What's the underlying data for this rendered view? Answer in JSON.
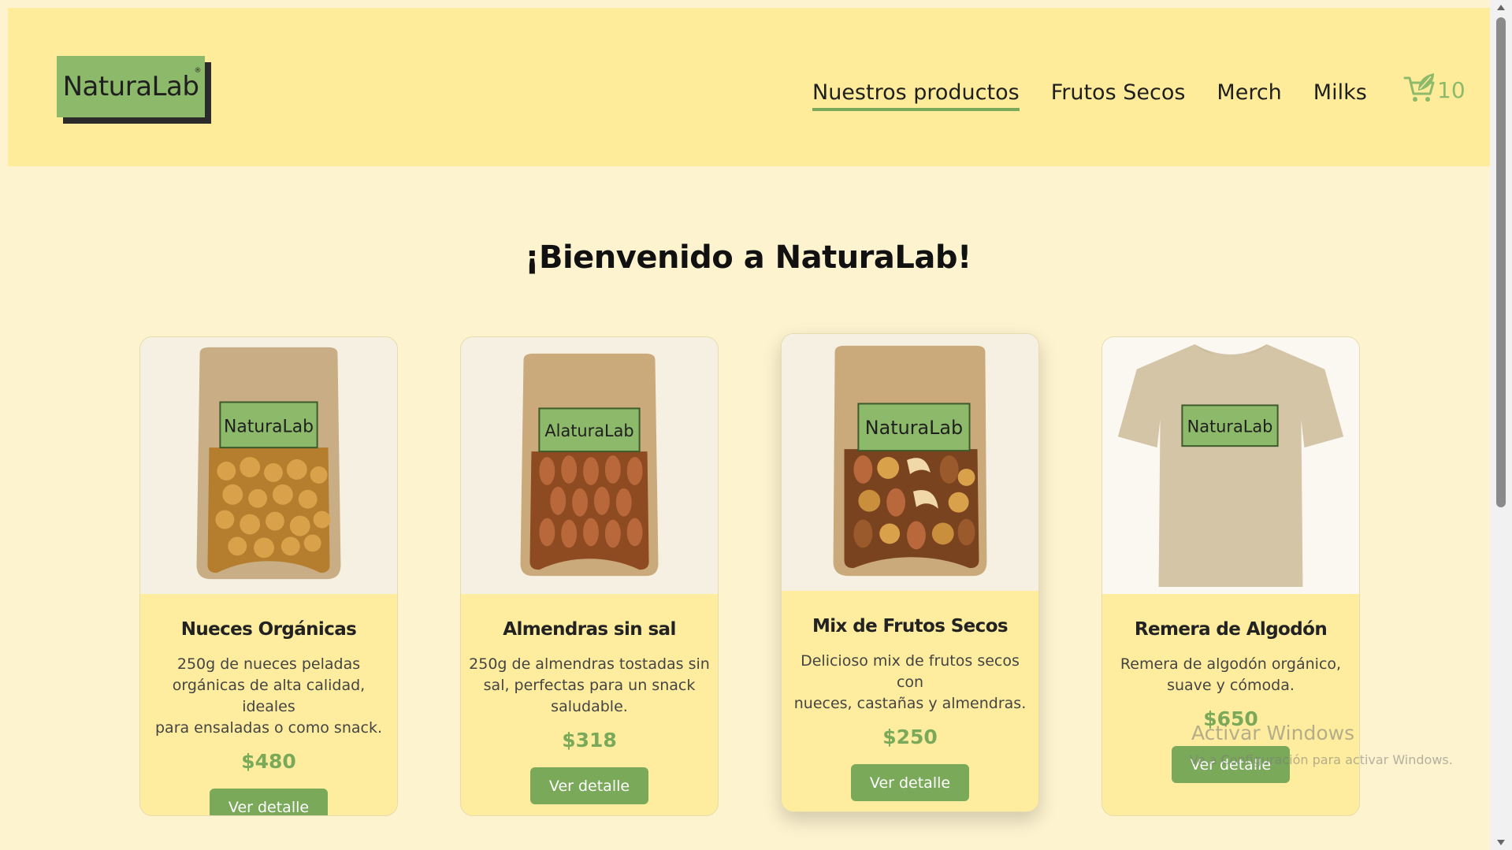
{
  "header": {
    "logo_text": "NaturaLab",
    "logo_mark": "®",
    "nav": [
      {
        "label": "Nuestros productos",
        "active": true
      },
      {
        "label": "Frutos Secos",
        "active": false
      },
      {
        "label": "Merch",
        "active": false
      },
      {
        "label": "Milks",
        "active": false
      }
    ],
    "cart_icon": "cart-leaf-icon",
    "cart_count": "10"
  },
  "main": {
    "welcome": "¡Bienvenido a NaturaLab!",
    "products": [
      {
        "title": "Nueces Orgánicas",
        "desc_lines": [
          "250g de nueces peladas",
          "orgánicas de alta calidad, ideales",
          "para ensaladas o como snack."
        ],
        "price": "$480",
        "button": "Ver detalle",
        "label": "NaturaLab"
      },
      {
        "title": "Almendras sin sal",
        "desc_lines": [
          "250g de almendras tostadas sin",
          "sal, perfectas para un snack",
          "saludable."
        ],
        "price": "$318",
        "button": "Ver detalle",
        "label": "AlaturaLab"
      },
      {
        "title": "Mix de Frutos Secos",
        "desc_lines": [
          "Delicioso mix de frutos secos con",
          "nueces, castañas y almendras."
        ],
        "price": "$250",
        "button": "Ver detalle",
        "label": "NaturaLab"
      },
      {
        "title": "Remera de Algodón",
        "desc_lines": [
          "Remera de algodón orgánico,",
          "suave y cómoda."
        ],
        "price": "$650",
        "button": "Ver detalle",
        "label": "NaturaLab"
      }
    ]
  },
  "overlay": {
    "watermark_title": "Activar Windows",
    "watermark_sub": "Ve a Configuración para activar Windows."
  },
  "colors": {
    "page_bg": "#fdf3cf",
    "header_bg": "#feec9a",
    "accent_green": "#7aa95a",
    "logo_green": "#8dba6a"
  }
}
